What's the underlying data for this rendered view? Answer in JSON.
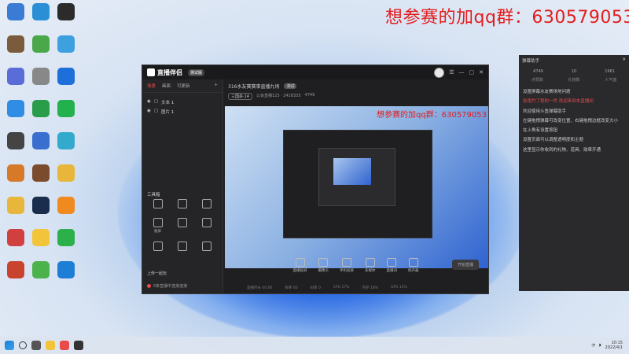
{
  "banner_text": "想参赛的加qq群：630579053",
  "desktop_icons": [
    {
      "label": "",
      "color": "#3a7bd5"
    },
    {
      "label": "",
      "color": "#7a5c3c"
    },
    {
      "label": "",
      "color": "#5a6cd8"
    },
    {
      "label": "",
      "color": "#2f8de4"
    },
    {
      "label": "",
      "color": "#444"
    },
    {
      "label": "",
      "color": "#d67a2a"
    },
    {
      "label": "",
      "color": "#e8b63a"
    },
    {
      "label": "",
      "color": "#d13f3f"
    },
    {
      "label": "",
      "color": "#c9442f"
    },
    {
      "label": "",
      "color": "#2b8fd6"
    },
    {
      "label": "",
      "color": "#4aa84a"
    },
    {
      "label": "",
      "color": "#888"
    },
    {
      "label": "",
      "color": "#2a9d4a"
    },
    {
      "label": "",
      "color": "#3a6fd0"
    },
    {
      "label": "",
      "color": "#7a4b2c"
    },
    {
      "label": "",
      "color": "#1a2d4d"
    },
    {
      "label": "",
      "color": "#f2c43a"
    },
    {
      "label": "",
      "color": "#4cb34c"
    },
    {
      "label": "",
      "color": "#2b2b2b"
    },
    {
      "label": "",
      "color": "#3fa0e0"
    },
    {
      "label": "",
      "color": "#1e6fd9"
    },
    {
      "label": "",
      "color": "#22b14c"
    },
    {
      "label": "",
      "color": "#3ac"
    },
    {
      "label": "",
      "color": "#e8b63a"
    },
    {
      "label": "",
      "color": "#f08a1e"
    },
    {
      "label": "",
      "color": "#2bb04a"
    },
    {
      "label": "",
      "color": "#1e7ed6"
    }
  ],
  "obs": {
    "title": "直播伴侣",
    "version": "测试版",
    "tabs": [
      "场景",
      "画面",
      "可更新"
    ],
    "scene_label": "",
    "sources": [
      "文本 1",
      "图片 1"
    ],
    "tools_title": "工具箱",
    "tools": [
      "",
      "",
      "",
      "截屏",
      "",
      "",
      "",
      "",
      ""
    ],
    "uplink_label": "上传一起玩",
    "status_text": "5条直播中连接连接",
    "room_title": "316水友赛赛事直播九场",
    "room_tag": "测试",
    "sub_info": [
      "三国杀·14",
      "公会直播123 · 2418333",
      "4749"
    ],
    "preview_banner": "想参赛的加qq群：630579053",
    "bottom_buttons": [
      "直播投屏",
      "摄像头",
      "手机投屏",
      "多媒体",
      "直播间",
      "扬声器"
    ],
    "live_button": "开始直播",
    "stats": [
      "直播时长 00:00",
      "帧率 60",
      "码率 0",
      "CPU 17%",
      "内存 18%",
      "GPU 15%"
    ]
  },
  "chat": {
    "title": "弹幕助手",
    "counts": [
      "4749",
      "10",
      "1961"
    ],
    "sub": [
      "点赞数",
      "礼物数",
      "人气值"
    ],
    "messages": [
      {
        "text": "设置屏幕水友赛场地问题",
        "red": false
      },
      {
        "text": "张雨竹了我的一件  欢迎来到本直播间",
        "red": true
      },
      {
        "text": "欢迎使用斗鱼弹幕助手",
        "red": false
      },
      {
        "text": "左键拖拽弹幕可改变位置、右键拖拽边框改变大小",
        "red": false
      },
      {
        "text": "在上角有设置按钮",
        "red": false
      },
      {
        "text": "设置页面可以调整透明度和主题",
        "red": false
      },
      {
        "text": "这里显示你收到的礼物、道具、勋章开通",
        "red": false
      }
    ]
  },
  "taskbar": {
    "time": "10:15",
    "date": "2022/4/1"
  }
}
